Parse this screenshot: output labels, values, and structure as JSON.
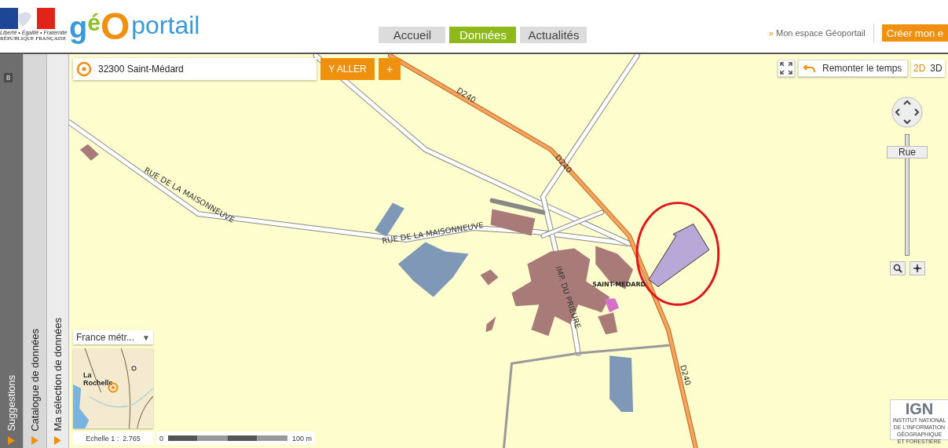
{
  "header": {
    "emblem_motto": "Liberté • Égalité • Fraternité",
    "emblem_country": "RÉPUBLIQUE FRANÇAISE",
    "brand_parts": [
      {
        "text": "g",
        "color": "#3a9ad9"
      },
      {
        "text": "é",
        "color": "#8dc21f"
      },
      {
        "text": "O",
        "color": "#f0900f"
      },
      {
        "text": "portail",
        "color": "#3a9ad9"
      }
    ],
    "nav_tabs": [
      {
        "label": "Accueil",
        "selected": false
      },
      {
        "label": "Données",
        "selected": true
      },
      {
        "label": "Actualités",
        "selected": false
      }
    ],
    "account_link_prefix": "»",
    "account_link": "Mon espace Géoportail",
    "create_button": "Créer mon e"
  },
  "side_panels": [
    {
      "label": "Suggestions",
      "counter": "8"
    },
    {
      "label": "Catalogue de données"
    },
    {
      "label": "Ma sélection de données"
    }
  ],
  "search": {
    "value": "32300 Saint-Médard",
    "go_button": "Y ALLER",
    "add_button": "+"
  },
  "map_toolbar": {
    "history_button": "Remonter le temps",
    "view_modes": [
      {
        "label": "2D",
        "selected": true
      },
      {
        "label": "3D",
        "selected": false
      }
    ]
  },
  "zoom": {
    "label": "Rue",
    "level": 0.82
  },
  "map_labels": [
    {
      "text": "D240",
      "kind": "road"
    },
    {
      "text": "D240",
      "kind": "road"
    },
    {
      "text": "D240",
      "kind": "road"
    },
    {
      "text": "RUE DE LA MAISONNEUVE",
      "kind": "road"
    },
    {
      "text": "RUE DE LA MAISONNEUVE",
      "kind": "road"
    },
    {
      "text": "IMP. DU PRIEURE",
      "kind": "road"
    },
    {
      "text": "SAINT-MEDARD",
      "kind": "place"
    }
  ],
  "minimap": {
    "territory": "France métr...",
    "caret": "▼",
    "place_label": "La Rochelle"
  },
  "scale": {
    "ratio": "Echelle 1 :  2.765",
    "start": "0",
    "end": "100 m"
  },
  "ign_logo": {
    "name": "IGN",
    "caption": [
      "INSTITUT NATIONAL",
      "DE L'INFORMATION",
      "GÉOGRAPHIQUE",
      "ET FORESTIÈRE"
    ]
  }
}
